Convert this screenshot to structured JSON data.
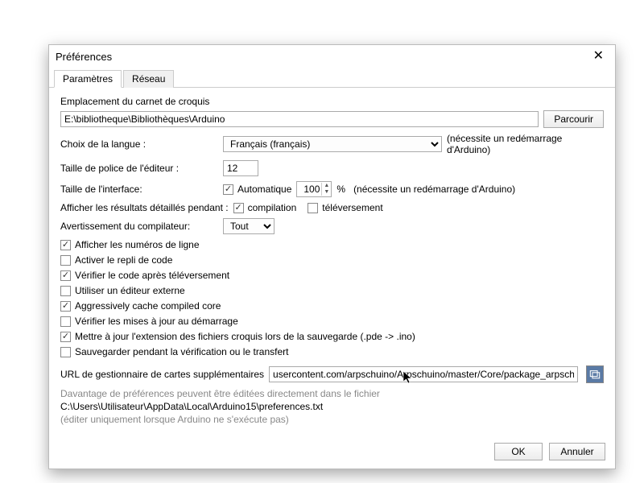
{
  "dialog": {
    "title": "Préférences",
    "tabs": {
      "params": "Paramètres",
      "network": "Réseau"
    }
  },
  "sketchbook": {
    "label": "Emplacement du carnet de croquis",
    "path": "E:\\bibliotheque\\Bibliothèques\\Arduino",
    "browse": "Parcourir"
  },
  "language": {
    "label": "Choix de la langue :",
    "value": "Français (français)",
    "restart_note": "(nécessite un redémarrage d'Arduino)"
  },
  "editor_font": {
    "label": "Taille de police de l'éditeur :",
    "value": "12"
  },
  "interface_scale": {
    "label": "Taille de l'interface:",
    "auto_label": "Automatique",
    "auto_checked": true,
    "percent": "100",
    "percent_suffix": "%",
    "restart_note": "(nécessite un redémarrage d'Arduino)"
  },
  "verbose": {
    "label": "Afficher les résultats détaillés pendant :",
    "compile_label": "compilation",
    "compile_checked": true,
    "upload_label": "téléversement",
    "upload_checked": false
  },
  "warnings": {
    "label": "Avertissement du compilateur:",
    "value": "Tout"
  },
  "checks": {
    "line_numbers": {
      "label": "Afficher les numéros de ligne",
      "checked": true
    },
    "code_folding": {
      "label": "Activer le repli de code",
      "checked": false
    },
    "verify_after_upload": {
      "label": "Vérifier le code après téléversement",
      "checked": true
    },
    "external_editor": {
      "label": "Utiliser un éditeur externe",
      "checked": false
    },
    "aggressive_cache": {
      "label": "Aggressively cache compiled core",
      "checked": true
    },
    "check_updates": {
      "label": "Vérifier les mises à jour au démarrage",
      "checked": false
    },
    "update_extension": {
      "label": "Mettre à jour  l'extension des fichiers croquis lors de la sauvegarde (.pde -> .ino)",
      "checked": true
    },
    "save_on_verify": {
      "label": "Sauvegarder pendant la vérification ou le transfert",
      "checked": false
    }
  },
  "boards_url": {
    "label": "URL de gestionnaire de cartes supplémentaires",
    "value": "usercontent.com/arpschuino/Arpschuino/master/Core/package_arpschuino_index.json"
  },
  "more_prefs": {
    "line1": "Davantage de préférences peuvent être éditées directement dans le fichier",
    "path": "C:\\Users\\Utilisateur\\AppData\\Local\\Arduino15\\preferences.txt",
    "line3": "(éditer uniquement lorsque Arduino ne s'exécute pas)"
  },
  "buttons": {
    "ok": "OK",
    "cancel": "Annuler"
  }
}
